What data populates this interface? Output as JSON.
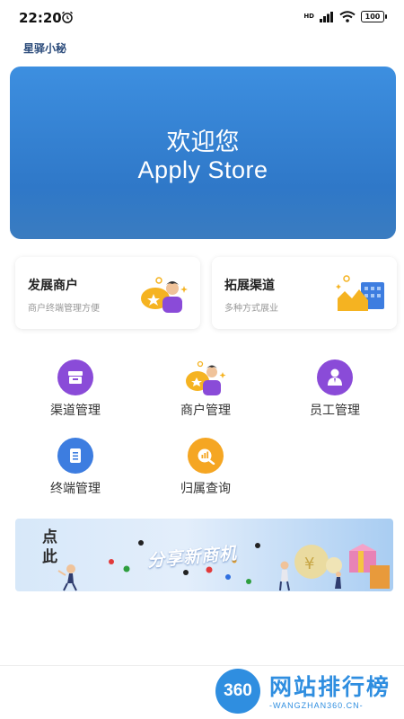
{
  "status_bar": {
    "time": "22:20",
    "network": "HD",
    "battery": "100"
  },
  "app": {
    "name": "星驿小秘"
  },
  "hero": {
    "line1": "欢迎您",
    "line2": "Apply Store"
  },
  "cards": [
    {
      "title": "发展商户",
      "subtitle": "商户终端管理方便"
    },
    {
      "title": "拓展渠道",
      "subtitle": "多种方式展业"
    }
  ],
  "grid": [
    {
      "label": "渠道管理"
    },
    {
      "label": "商户管理"
    },
    {
      "label": "员工管理"
    },
    {
      "label": "终端管理"
    },
    {
      "label": "归属查询"
    }
  ],
  "banner": {
    "headline": "分享新商机",
    "calligraphy": "点此"
  },
  "watermark": {
    "logo": "360",
    "title": "网站排行榜",
    "url": "-WANGZHAN360.CN-"
  },
  "colors": {
    "hero_blue": "#3a86d6",
    "purple": "#8a4bd8",
    "orange": "#f5a623",
    "blue_icon": "#3d7de0",
    "brand": "#2f8ee0"
  }
}
